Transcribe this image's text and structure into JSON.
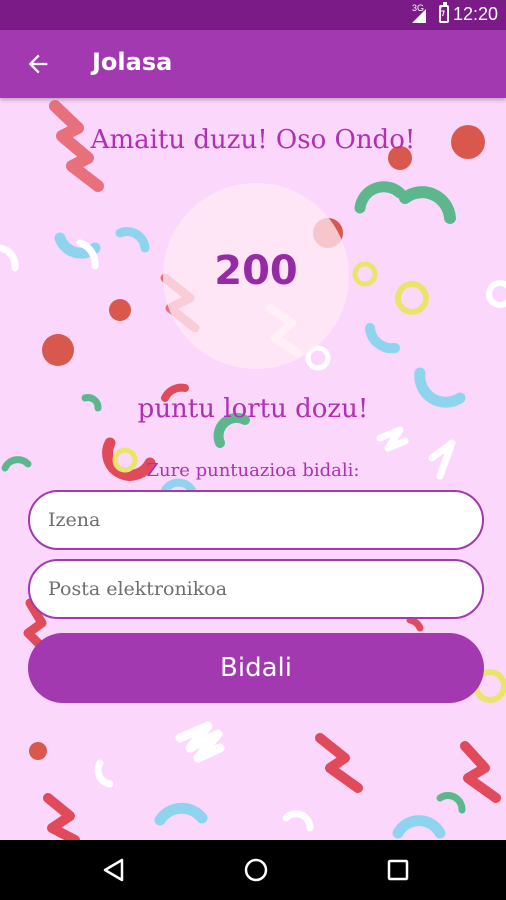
{
  "status_bar": {
    "network": "3G",
    "time": "12:20"
  },
  "app_bar": {
    "title": "Jolasa",
    "back_icon": "arrow-left-icon"
  },
  "result": {
    "headline": "Amaitu duzu! Oso Ondo!",
    "score": "200",
    "points_text": "puntu lortu dozu!",
    "submit_label": "Zure puntuazioa bidali:"
  },
  "form": {
    "name": {
      "value": "",
      "placeholder": "Izena"
    },
    "email": {
      "value": "",
      "placeholder": "Posta elektronikoa"
    },
    "send_label": "Bidali"
  },
  "nav_bar": {
    "back_icon": "triangle-back-icon",
    "home_icon": "circle-home-icon",
    "recents_icon": "square-recents-icon"
  },
  "colors": {
    "accent": "#a239b0",
    "status_bar": "#7b1b87",
    "background": "#fbd7fb",
    "text_accent": "#b02fb2"
  }
}
